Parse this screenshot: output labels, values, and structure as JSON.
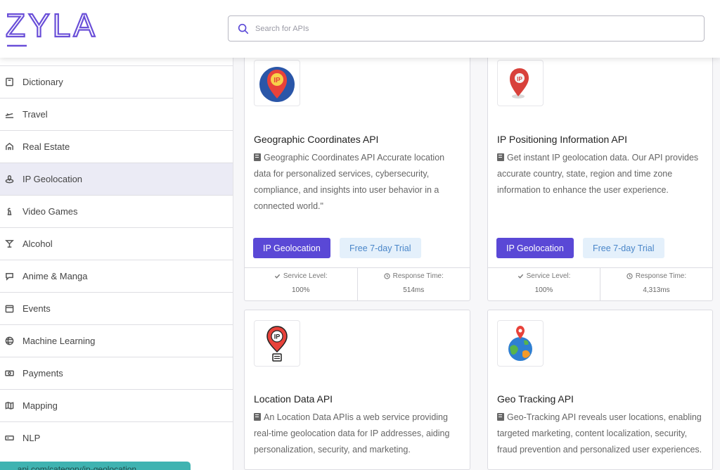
{
  "header": {
    "logo_text": "ZYLA",
    "search": {
      "placeholder": "Search for APIs",
      "value": ""
    }
  },
  "sidebar": {
    "items": [
      {
        "label": "Dictionary",
        "icon": "book-icon"
      },
      {
        "label": "Travel",
        "icon": "plane-icon"
      },
      {
        "label": "Real Estate",
        "icon": "house-icon"
      },
      {
        "label": "IP Geolocation",
        "icon": "geolocation-icon",
        "active": true
      },
      {
        "label": "Video Games",
        "icon": "chess-icon"
      },
      {
        "label": "Alcohol",
        "icon": "glass-icon"
      },
      {
        "label": "Anime & Manga",
        "icon": "chat-bubble-icon"
      },
      {
        "label": "Events",
        "icon": "calendar-icon"
      },
      {
        "label": "Machine Learning",
        "icon": "globe-icon"
      },
      {
        "label": "Payments",
        "icon": "money-icon"
      },
      {
        "label": "Mapping",
        "icon": "map-icon"
      },
      {
        "label": "NLP",
        "icon": "language-icon"
      }
    ],
    "toast_text": "..api.com/category/ip-geolocation"
  },
  "cards": [
    {
      "title": "Geographic Coordinates API",
      "description": "Geographic Coordinates API Accurate location data for personalized services, cybersecurity, compliance, and insights into user behavior in a connected world.\"",
      "category_button": "IP Geolocation",
      "trial_button": "Free 7-day Trial",
      "service_level_label": "Service Level:",
      "service_level_value": "100%",
      "response_time_label": "Response Time:",
      "response_time_value": "514ms",
      "logo_icon": "ip-pin-blue-circle-icon"
    },
    {
      "title": "IP Positioning Information API",
      "description": "Get instant IP geolocation data. Our API provides accurate country, state, region and time zone information to enhance the user experience.",
      "category_button": "IP Geolocation",
      "trial_button": "Free 7-day Trial",
      "service_level_label": "Service Level:",
      "service_level_value": "100%",
      "response_time_label": "Response Time:",
      "response_time_value": "4,313ms",
      "logo_icon": "ip-pin-red-icon"
    },
    {
      "title": "Location Data API",
      "description": "An Location Data APIis a web service providing real-time geolocation data for IP addresses, aiding personalization, security, and marketing.",
      "logo_icon": "ip-pin-server-icon"
    },
    {
      "title": "Geo Tracking API",
      "description": "Geo-Tracking API reveals user locations, enabling targeted marketing, content localization, security, fraud prevention and personalized user experiences.",
      "logo_icon": "globe-pin-icon"
    }
  ],
  "colors": {
    "brand": "#5a48d6",
    "trial_bg": "#e4f0fb",
    "trial_text": "#4a86c9",
    "active_sidebar": "#ebebf5"
  }
}
